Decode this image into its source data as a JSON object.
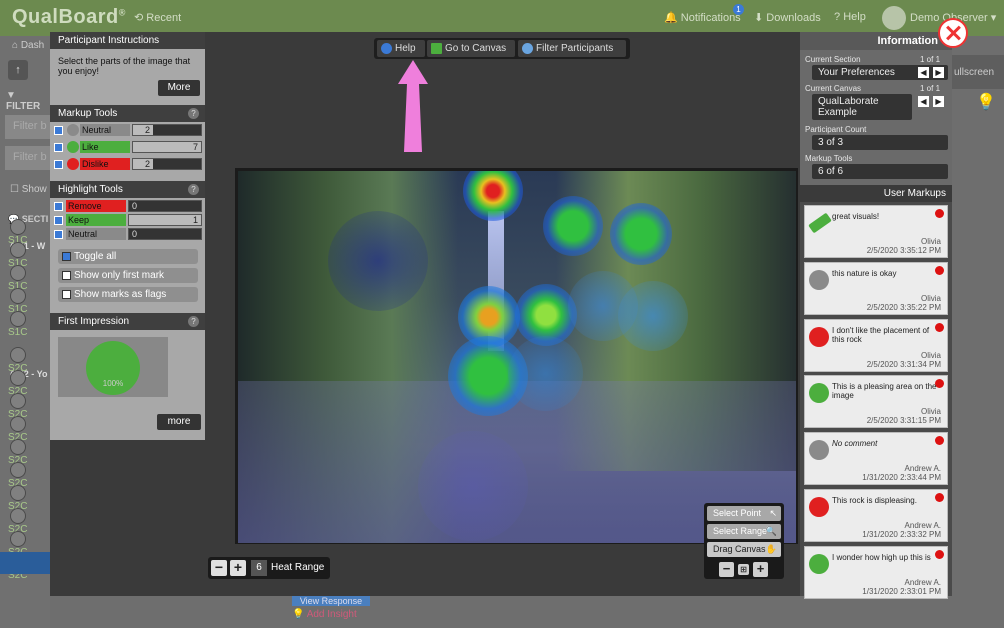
{
  "topbar": {
    "logo": "QualBoard",
    "recent": "Recent",
    "notifications": "Notifications",
    "notifications_badge": "1",
    "downloads": "Downloads",
    "help": "Help",
    "user": "Demo Observer"
  },
  "background": {
    "dash": "Dash",
    "filter": "FILTER",
    "filter_placeholder_1": "Filter b",
    "filter_placeholder_2": "Filter b",
    "show": "Show",
    "sections": "SECTI",
    "s1": "S1 - W",
    "s2": "S2 - Yo",
    "fullscreen": "ullscreen",
    "view_response": "View Response",
    "add_insight": "Add Insight",
    "rows_s1": [
      "S1C",
      "S1C",
      "S1C",
      "S1C",
      "S1C"
    ],
    "rows_s2": [
      "S2C",
      "S2C",
      "S2C",
      "S2C",
      "S2C",
      "S2C",
      "S2C",
      "S2C",
      "S2C",
      "S2C"
    ]
  },
  "instructions": {
    "title": "Participant Instructions",
    "text": "Select the parts of the image that you enjoy!",
    "more": "More"
  },
  "markup_tools": {
    "title": "Markup Tools",
    "items": [
      {
        "label": "Neutral",
        "count": "2",
        "fill": 0.29,
        "color": "#8a8a8a"
      },
      {
        "label": "Like",
        "count": "7",
        "fill": 1.0,
        "color": "#4cae3e"
      },
      {
        "label": "Dislike",
        "count": "2",
        "fill": 0.29,
        "color": "#e02020"
      }
    ]
  },
  "highlight_tools": {
    "title": "Highlight Tools",
    "items": [
      {
        "label": "Remove",
        "count": "0",
        "fill": 0,
        "color": "#e02020"
      },
      {
        "label": "Keep",
        "count": "1",
        "fill": 1.0,
        "color": "#4cae3e"
      },
      {
        "label": "Neutral",
        "count": "0",
        "fill": 0,
        "color": "#8a8a8a"
      }
    ],
    "toggle_all": "Toggle all",
    "only_first": "Show only first mark",
    "as_flags": "Show marks as flags"
  },
  "first_impression": {
    "title": "First Impression",
    "percent": "100%",
    "more": "more"
  },
  "toolbar": {
    "help": "Help",
    "go_to_canvas": "Go to Canvas",
    "filter_participants": "Filter Participants"
  },
  "heat": {
    "value": "6",
    "label": "Heat Range"
  },
  "select_tools": {
    "select_point": "Select Point",
    "select_range": "Select Range",
    "drag_canvas": "Drag Canvas"
  },
  "information": {
    "title": "Information",
    "current_section_label": "Current Section",
    "current_section_frac": "1 of 1",
    "current_section": "Your Preferences",
    "current_canvas_label": "Current Canvas",
    "current_canvas_frac": "1 of 1",
    "current_canvas": "QualLaborate Example",
    "participant_count_label": "Participant Count",
    "participant_count": "3 of 3",
    "markup_tools_label": "Markup Tools",
    "markup_tools": "6 of 6"
  },
  "user_markups": {
    "title": "User Markups",
    "items": [
      {
        "type": "highlight",
        "text": "great visuals!",
        "author": "Olivia",
        "date": "2/5/2020 3:35:12 PM"
      },
      {
        "type": "neutral",
        "text": "this nature is okay",
        "author": "Olivia",
        "date": "2/5/2020 3:35:22 PM"
      },
      {
        "type": "dislike",
        "text": "I don't like the placement of this rock",
        "author": "Olivia",
        "date": "2/5/2020 3:31:34 PM"
      },
      {
        "type": "like",
        "text": "This is a pleasing area on the image",
        "author": "Olivia",
        "date": "2/5/2020 3:31:15 PM"
      },
      {
        "type": "neutral",
        "text": "No comment",
        "author": "Andrew A.",
        "date": "1/31/2020 2:33:44 PM"
      },
      {
        "type": "dislike",
        "text": "This rock is displeasing.",
        "author": "Andrew A.",
        "date": "1/31/2020 2:33:32 PM"
      },
      {
        "type": "like",
        "text": "I wonder how high up this is",
        "author": "Andrew A.",
        "date": "1/31/2020 2:33:01 PM"
      }
    ]
  },
  "colors": {
    "like": "#4cae3e",
    "dislike": "#e02020",
    "neutral": "#8a8a8a",
    "accent_arrow": "#ef7fdc",
    "topbar": "#6c8a4f"
  }
}
